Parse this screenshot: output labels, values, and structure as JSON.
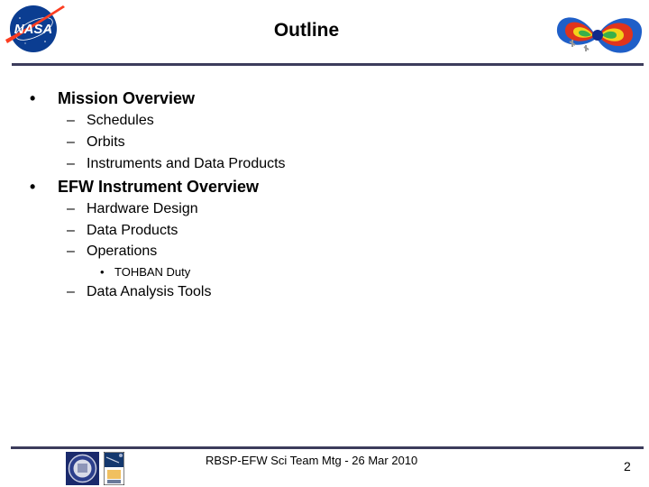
{
  "slide": {
    "title": "Outline",
    "logos": {
      "top_left": "nasa-meatball-logo",
      "top_right": "radiation-belts-graphic",
      "footer_left": "uc-berkeley-seal",
      "footer_right": "ssl-space-sciences-lab-logo"
    },
    "outline": [
      {
        "bullet": "•",
        "label": "Mission Overview",
        "children": [
          {
            "dash": "–",
            "label": "Schedules"
          },
          {
            "dash": "–",
            "label": "Orbits"
          },
          {
            "dash": "–",
            "label": "Instruments and Data Products"
          }
        ]
      },
      {
        "bullet": "•",
        "label": "EFW Instrument Overview",
        "children": [
          {
            "dash": "–",
            "label": "Hardware Design"
          },
          {
            "dash": "–",
            "label": "Data Products"
          },
          {
            "dash": "–",
            "label": "Operations",
            "children": [
              {
                "bullet": "•",
                "label": "TOHBAN Duty"
              }
            ]
          },
          {
            "dash": "–",
            "label": "Data Analysis Tools"
          }
        ]
      }
    ],
    "footer": {
      "text": "RBSP-EFW Sci Team Mtg - 26 Mar 2010",
      "page_number": "2"
    },
    "colors": {
      "rule": "#3c3c5c",
      "nasa_blue": "#0b3d91",
      "nasa_red": "#fc3d21"
    }
  }
}
